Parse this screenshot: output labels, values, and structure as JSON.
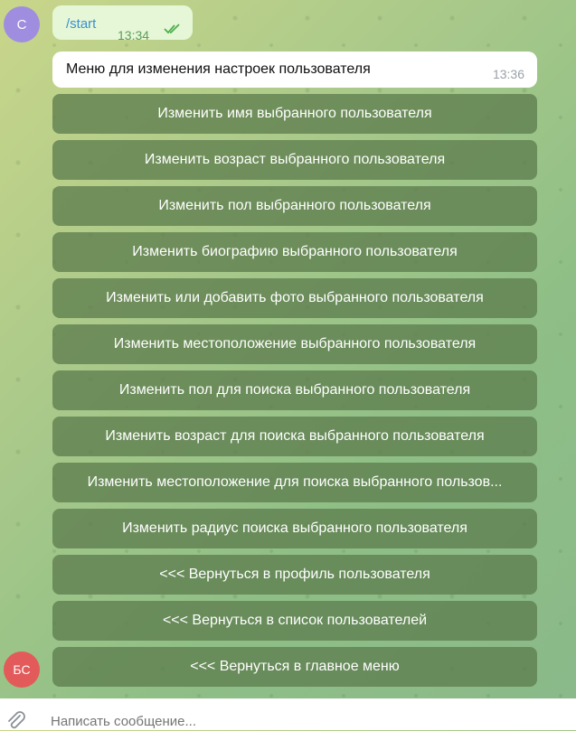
{
  "avatars": {
    "user": "С",
    "bot": "БС"
  },
  "outgoing": {
    "text": "/start",
    "time": "13:34",
    "status_icon": "double-check-icon"
  },
  "incoming": {
    "text": "Меню для изменения настроек пользователя",
    "time": "13:36"
  },
  "keyboard": [
    "Изменить имя выбранного пользователя",
    "Изменить возраст выбранного пользователя",
    "Изменить пол выбранного пользователя",
    "Изменить биографию выбранного пользователя",
    "Изменить или добавить фото выбранного пользователя",
    "Изменить местоположение выбранного пользователя",
    "Изменить пол для поиска выбранного пользователя",
    "Изменить возраст для поиска выбранного пользователя",
    "Изменить местоположение для поиска выбранного пользов...",
    "Изменить радиус поиска выбранного пользователя",
    "<<< Вернуться в профиль пользователя",
    "<<< Вернуться в список пользователей",
    "<<< Вернуться в главное меню"
  ],
  "composer": {
    "placeholder": "Написать сообщение..."
  },
  "colors": {
    "button": "#5e7e4e",
    "outgoing_bubble": "#e6f7d7",
    "link": "#3a8fcf"
  }
}
